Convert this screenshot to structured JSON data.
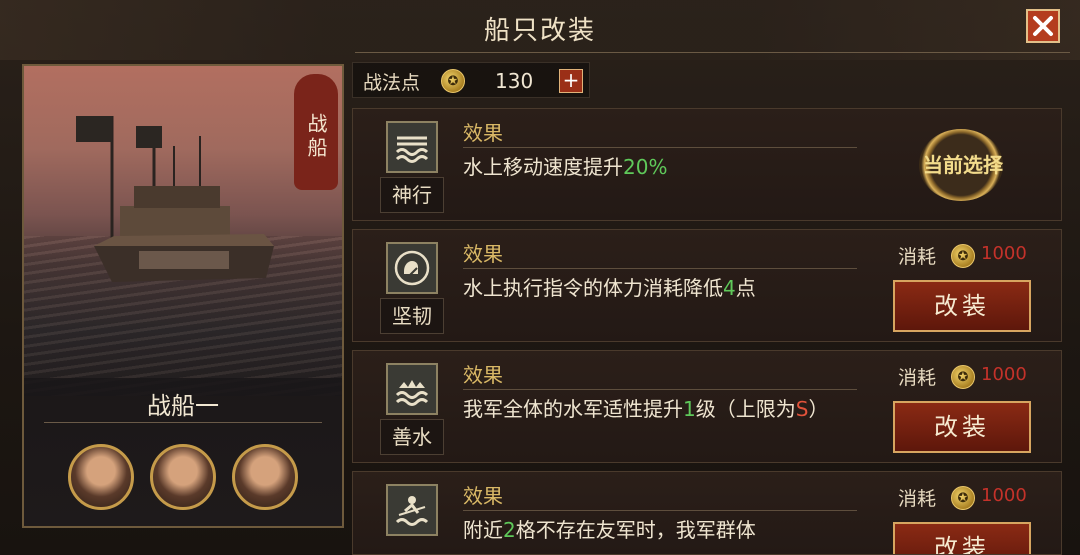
{
  "window": {
    "title": "船只改装"
  },
  "ship": {
    "type_tag": "战船",
    "name": "战船一",
    "generals": [
      "general-portrait-1",
      "general-portrait-2",
      "general-portrait-3"
    ]
  },
  "tactic_points": {
    "label": "战法点",
    "value": "130",
    "add_label": "+"
  },
  "options": [
    {
      "icon": "waves-speed-icon",
      "name": "神行",
      "effect_label": "效果",
      "effect_text": [
        "水上移动速度提升",
        "20%",
        ""
      ],
      "status": "当前选择"
    },
    {
      "icon": "fist-icon",
      "name": "坚韧",
      "effect_label": "效果",
      "effect_text": [
        "水上执行指令的体力消耗降低",
        "4",
        "点"
      ],
      "cost_label": "消耗",
      "cost_value": "1000",
      "button_label": "改装"
    },
    {
      "icon": "soldier-wave-icon",
      "name": "善水",
      "effect_label": "效果",
      "effect_text": [
        "我军全体的水军适性提升",
        "1",
        "级（上限为",
        "S",
        "）"
      ],
      "cost_label": "消耗",
      "cost_value": "1000",
      "button_label": "改装"
    },
    {
      "icon": "rowing-icon",
      "name": "",
      "effect_label": "效果",
      "effect_text": [
        "附近",
        "2",
        "格不存在友军时，我军群体"
      ],
      "cost_label": "消耗",
      "cost_value": "1000",
      "button_label": "改装"
    }
  ]
}
